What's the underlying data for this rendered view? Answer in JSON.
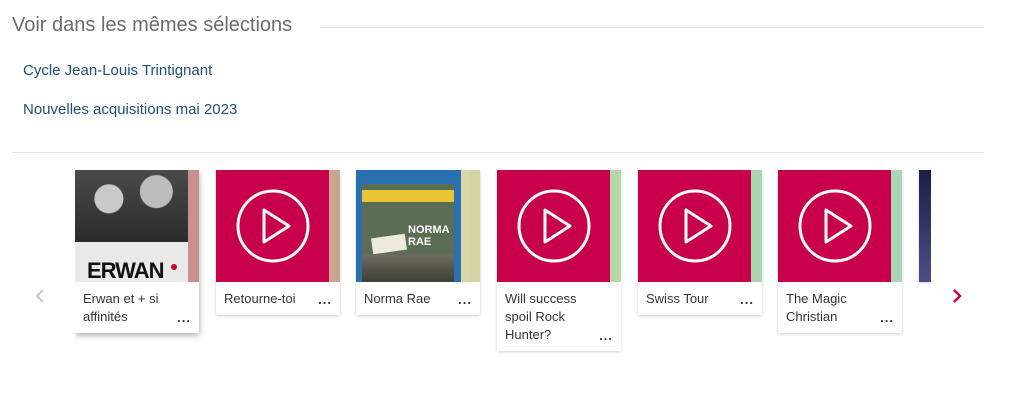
{
  "section": {
    "title": "Voir dans les mêmes sélections"
  },
  "selections": [
    {
      "label": "Cycle Jean-Louis Trintignant"
    },
    {
      "label": "Nouvelles acquisitions mai 2023"
    }
  ],
  "carousel": {
    "prev_icon": "chevron-left-icon",
    "next_icon": "chevron-right-icon",
    "colors": {
      "play_bg": "#c8004b",
      "arrow_active": "#c8004b",
      "arrow_inactive": "#c6c6c6"
    },
    "items": [
      {
        "title": "Erwan et + si affinités",
        "more": "...",
        "cover": "poster",
        "poster_text": "ERWAN",
        "strip_color": "#c98e8e"
      },
      {
        "title": "Retourne-toi",
        "more": "...",
        "cover": "play-icon",
        "strip_color": "#c8a78f"
      },
      {
        "title": "Norma Rae",
        "more": "...",
        "cover": "bluray",
        "poster_text": "NORMA RAE",
        "strip_color": "#d6d3a6"
      },
      {
        "title": "Will success spoil Rock Hunter?",
        "more": "...",
        "cover": "play-icon",
        "strip_color": "#b5d6a5"
      },
      {
        "title": "Swiss Tour",
        "more": "...",
        "cover": "play-icon",
        "strip_color": "#a9d6b0"
      },
      {
        "title": "The Magic Christian",
        "more": "...",
        "cover": "play-icon",
        "strip_color": "#a9d6b6"
      },
      {
        "title": "",
        "more": "",
        "cover": "partial",
        "strip_color": "#2c2f5a"
      }
    ]
  }
}
